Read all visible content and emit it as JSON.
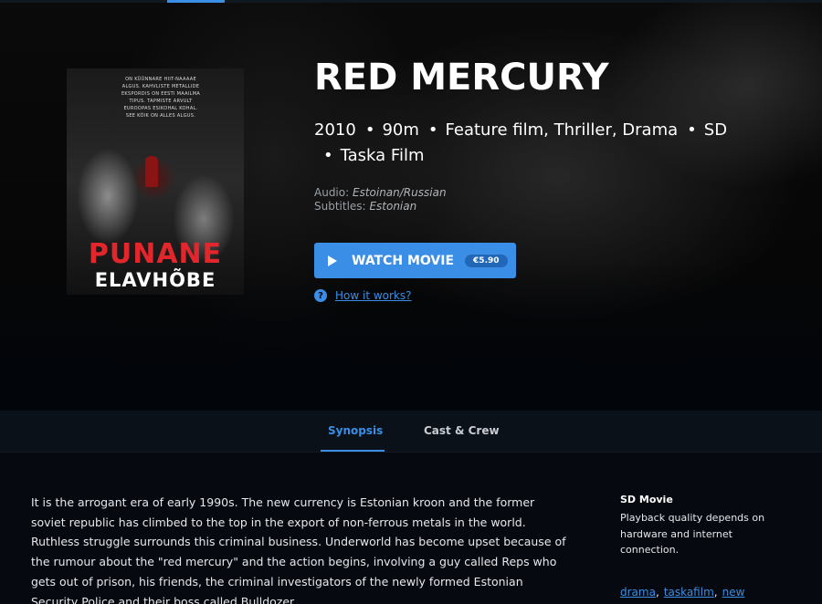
{
  "movie": {
    "title": "RED MERCURY",
    "year": "2010",
    "duration": "90m",
    "genres": "Feature film, Thriller, Drama",
    "quality": "SD",
    "studio": "Taska Film",
    "audio_label": "Audio:",
    "audio_value": "Estoinan/Russian",
    "subtitles_label": "Subtitles:",
    "subtitles_value": "Estonian",
    "meta_separator": "•"
  },
  "poster": {
    "tagline": "ON KÜÜNNARE HIIT-NAAAAE ALGUS. KAHVLISTE METALLIDE EKSPORDIS ON EESTI MAAILMA TIPUS. TAPMISTE ARVULT EUROOPAS ESIKOHAL KOHAL. SEE KÕIK ON ALLES ALGUS.",
    "title_line1": "PUNANE",
    "title_line2": "ELAVHÕBE"
  },
  "watch": {
    "label": "WATCH MOVIE",
    "price": "€5.90"
  },
  "help": {
    "icon_glyph": "?",
    "label": "How it works?"
  },
  "tabs": {
    "synopsis": "Synopsis",
    "cast": "Cast & Crew"
  },
  "synopsis": "It is the arrogant era of early 1990s. The new currency is Estonian kroon and the former soviet republic has climbed to the top in the export of non-ferrous metals in the world. Ruthless struggle surrounds this criminal business. Underworld has become upset because of the rumour about the \"red mercury\" and the action begins, involving a guy called Reps who gets out of prison, his friends, the criminal investigators of the newly formed Estonian Security Police and their boss called Bulldozer.",
  "sidebar": {
    "title": "SD Movie",
    "text": "Playback quality depends on hardware and internet connection.",
    "tags": [
      "drama",
      "taskafilm",
      "new"
    ],
    "tag_separator": ","
  },
  "colors": {
    "accent": "#3a8ee6",
    "badge": "#2266b8",
    "background": "#02050b"
  },
  "icons": {
    "play": "play-icon",
    "help": "question-circle-icon"
  }
}
